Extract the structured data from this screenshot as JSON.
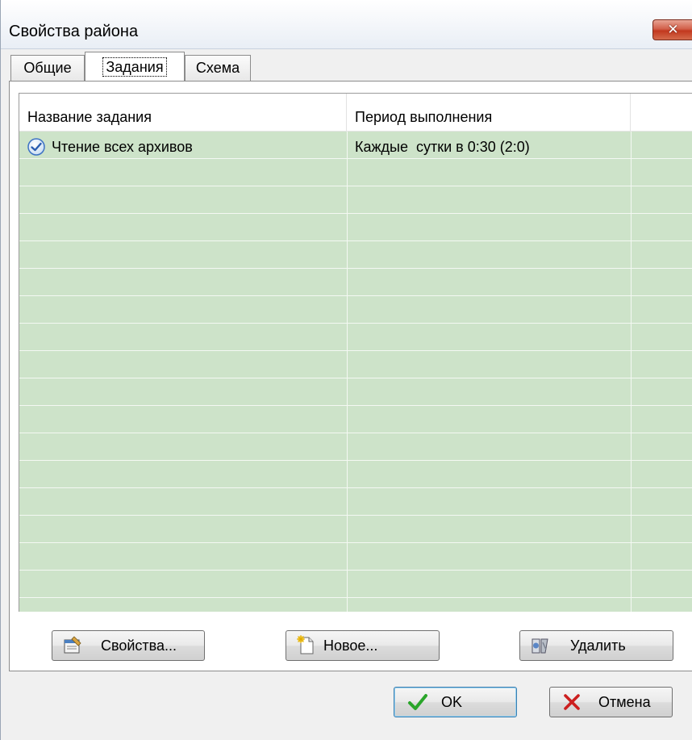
{
  "window": {
    "title": "Свойства района",
    "close_label": "✕"
  },
  "tabs": [
    {
      "label": "Общие",
      "active": false
    },
    {
      "label": "Задания",
      "active": true
    },
    {
      "label": "Схема",
      "active": false
    }
  ],
  "table": {
    "columns": [
      "Название задания",
      "Период выполнения"
    ],
    "rows": [
      {
        "name": "Чтение всех архивов",
        "period": "Каждые  сутки в 0:30 (2:0)",
        "icon": "check-circle-icon"
      }
    ],
    "row_background": "#cde3c9"
  },
  "task_buttons": {
    "properties": "Свойства...",
    "new": "Новое...",
    "delete": "Удалить"
  },
  "dialog_buttons": {
    "ok": "OK",
    "cancel": "Отмена"
  },
  "colors": {
    "ok_check": "#2aa52a",
    "cancel_x": "#cc1f1f",
    "close_button": "#c2381f"
  }
}
